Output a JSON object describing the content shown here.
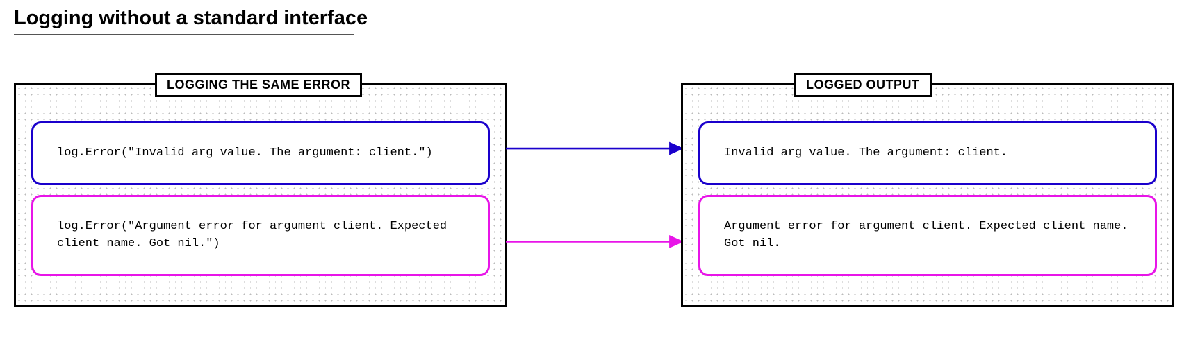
{
  "title": "Logging without a standard interface",
  "panels": {
    "left": {
      "label": "LOGGING THE SAME ERROR",
      "boxes": [
        {
          "text": "log.Error(\"Invalid arg value. The argument: client.\")",
          "color": "blue"
        },
        {
          "text": "log.Error(\"Argument error for argument client. Expected client name. Got nil.\")",
          "color": "magenta"
        }
      ]
    },
    "right": {
      "label": "LOGGED OUTPUT",
      "boxes": [
        {
          "text": "Invalid arg value. The argument: client.",
          "color": "blue"
        },
        {
          "text": "Argument error for argument client. Expected client name. Got nil.",
          "color": "magenta"
        }
      ]
    }
  },
  "colors": {
    "blue": "#1a00cc",
    "magenta": "#e815e8"
  }
}
